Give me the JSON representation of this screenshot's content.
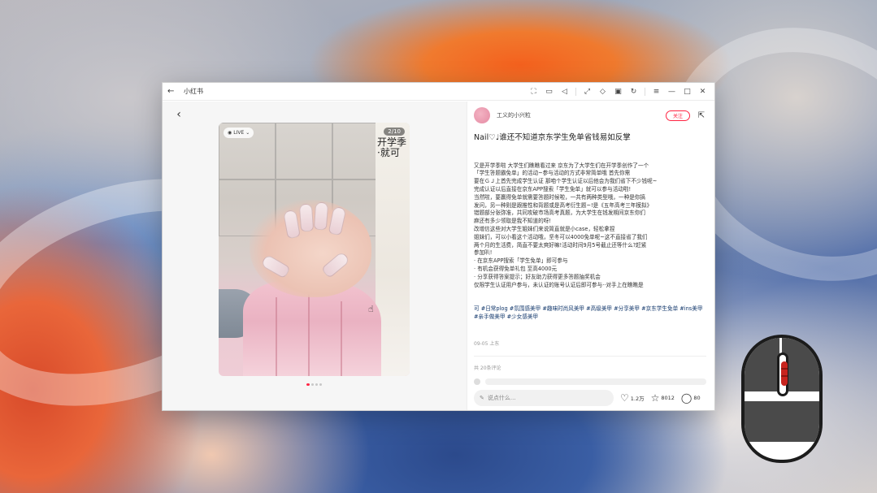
{
  "window": {
    "title": "小红书",
    "toolbar_icons": [
      "crop-icon",
      "camera-icon",
      "speaker-icon",
      "fullscreen-icon",
      "pin-icon",
      "pip-icon",
      "refresh-icon",
      "menu-icon",
      "minimize-icon",
      "maximize-icon",
      "close-icon"
    ]
  },
  "media": {
    "live_label": "LIVE",
    "counter": "2/10",
    "side_text": "开学季·就可",
    "dots_total": 4,
    "dots_active_index": 0
  },
  "author": {
    "name": "工义的小兴粒",
    "follow_label": "关注"
  },
  "note": {
    "title": "Nail♡♩谁还不知道京东学生免单省钱易如反掌",
    "body_lines": [
      "又是开学季啦 大学生们瞧瞧看过来 京东为了大学生们在开学季创作了一个",
      "「学生答题霸免单」的活动~参与活动的方式非常简单哦 首先你需",
      "要在ＧＪ上首先完成学生认证 那咱个学生认证以后他会为我们省下不少钱呢~",
      "完成认证以后直接在京东APP搜索「学生免单」就可以参与活动啦!",
      "当然啦，要赢得免单就需要答题时候啦，一共有两种类型哦，一种是你搞",
      "发问，另一种则是跟推性和背题或是高考衍生题~!是《五年高考三年模拟》",
      "错题部分张弥准，共同攻破市场高考真题，为大学生在钱发期间京东你们",
      "麻还有多少领取是我不知道的呀!",
      "改增信这些对大学生姐妹们来说简直就是小case，轻松拿捏",
      "姐妹们，可以小看这个活动哦，坚冬可以4000免单呢~这不直接省了我们",
      "两个月的生活费，简直不要太爽好嘛!活动时间9月5号截止还等什么?赶紧",
      "参加叭!",
      "· 在京东APP搜索「学生免单」即可参与",
      "· 有机会获得免单礼包 至高4000元",
      "· 分享获得答案提示；好友助力获得更多答题抽奖机会",
      "仅限学生认证用户参与，未认证的账号认证后即可参与··对手上在瞧瞧是"
    ],
    "tags": "可 #日常plog #氛围感美甲 #趣味时尚风美甲 #高级美甲 #分享美甲 #京东学生免单 #ins美甲 #亲手做美甲 #少女感美甲",
    "date": "09-05 上东"
  },
  "comments": {
    "count_label": "共 20条评论"
  },
  "bottom_bar": {
    "input_placeholder": "说点什么...",
    "likes": "1.2万",
    "favorites": "8012",
    "comments": "80"
  },
  "colors": {
    "accent": "#ff2442"
  }
}
